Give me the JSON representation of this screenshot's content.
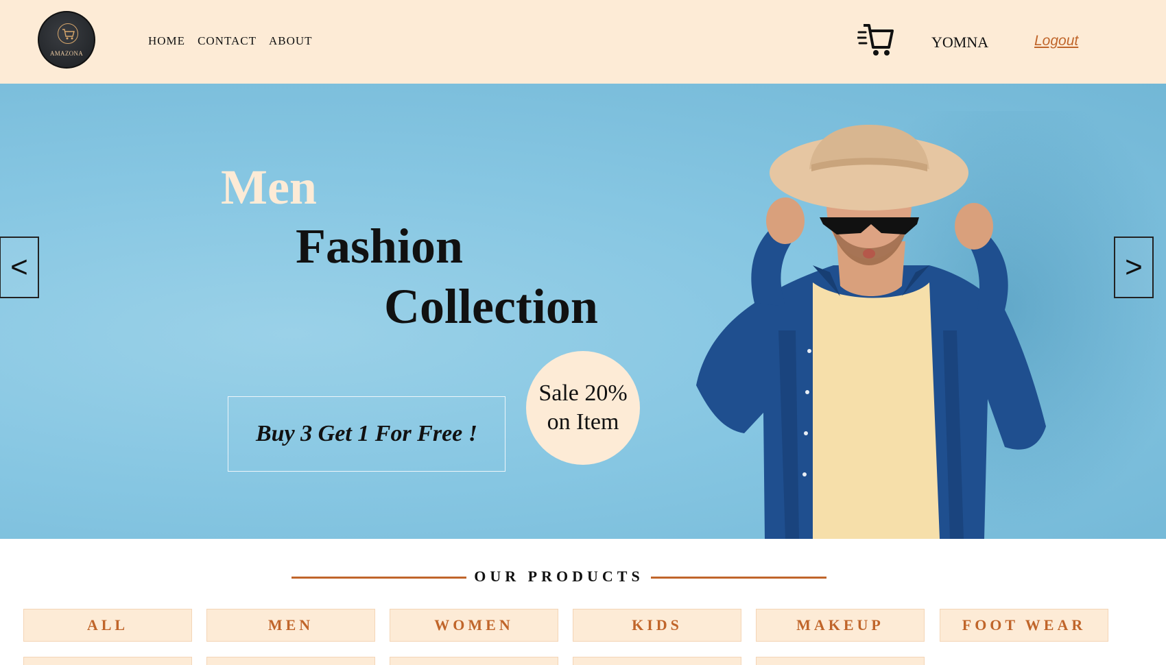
{
  "header": {
    "logo_text": "AMAZONA",
    "nav": [
      "HOME",
      "CONTACT",
      "ABOUT"
    ],
    "cart_icon": "shopping-cart-icon",
    "user_name": "YOMNA",
    "logout_label": "Logout"
  },
  "hero": {
    "title_line_1": "Men",
    "title_line_2": "Fashion",
    "title_line_3": "Collection",
    "promo": "Buy 3 Get 1 For Free !",
    "sale_line_1": "Sale 20%",
    "sale_line_2": "on Item",
    "prev_label": "<",
    "next_label": ">"
  },
  "products": {
    "heading": "OUR PRODUCTS",
    "categories": [
      "ALL",
      "MEN",
      "WOMEN",
      "KIDS",
      "MAKEUP",
      "FOOT WEAR"
    ]
  },
  "colors": {
    "cream": "#fdebd6",
    "accent": "#c0652a",
    "hero_blue": "#86c6e2"
  }
}
